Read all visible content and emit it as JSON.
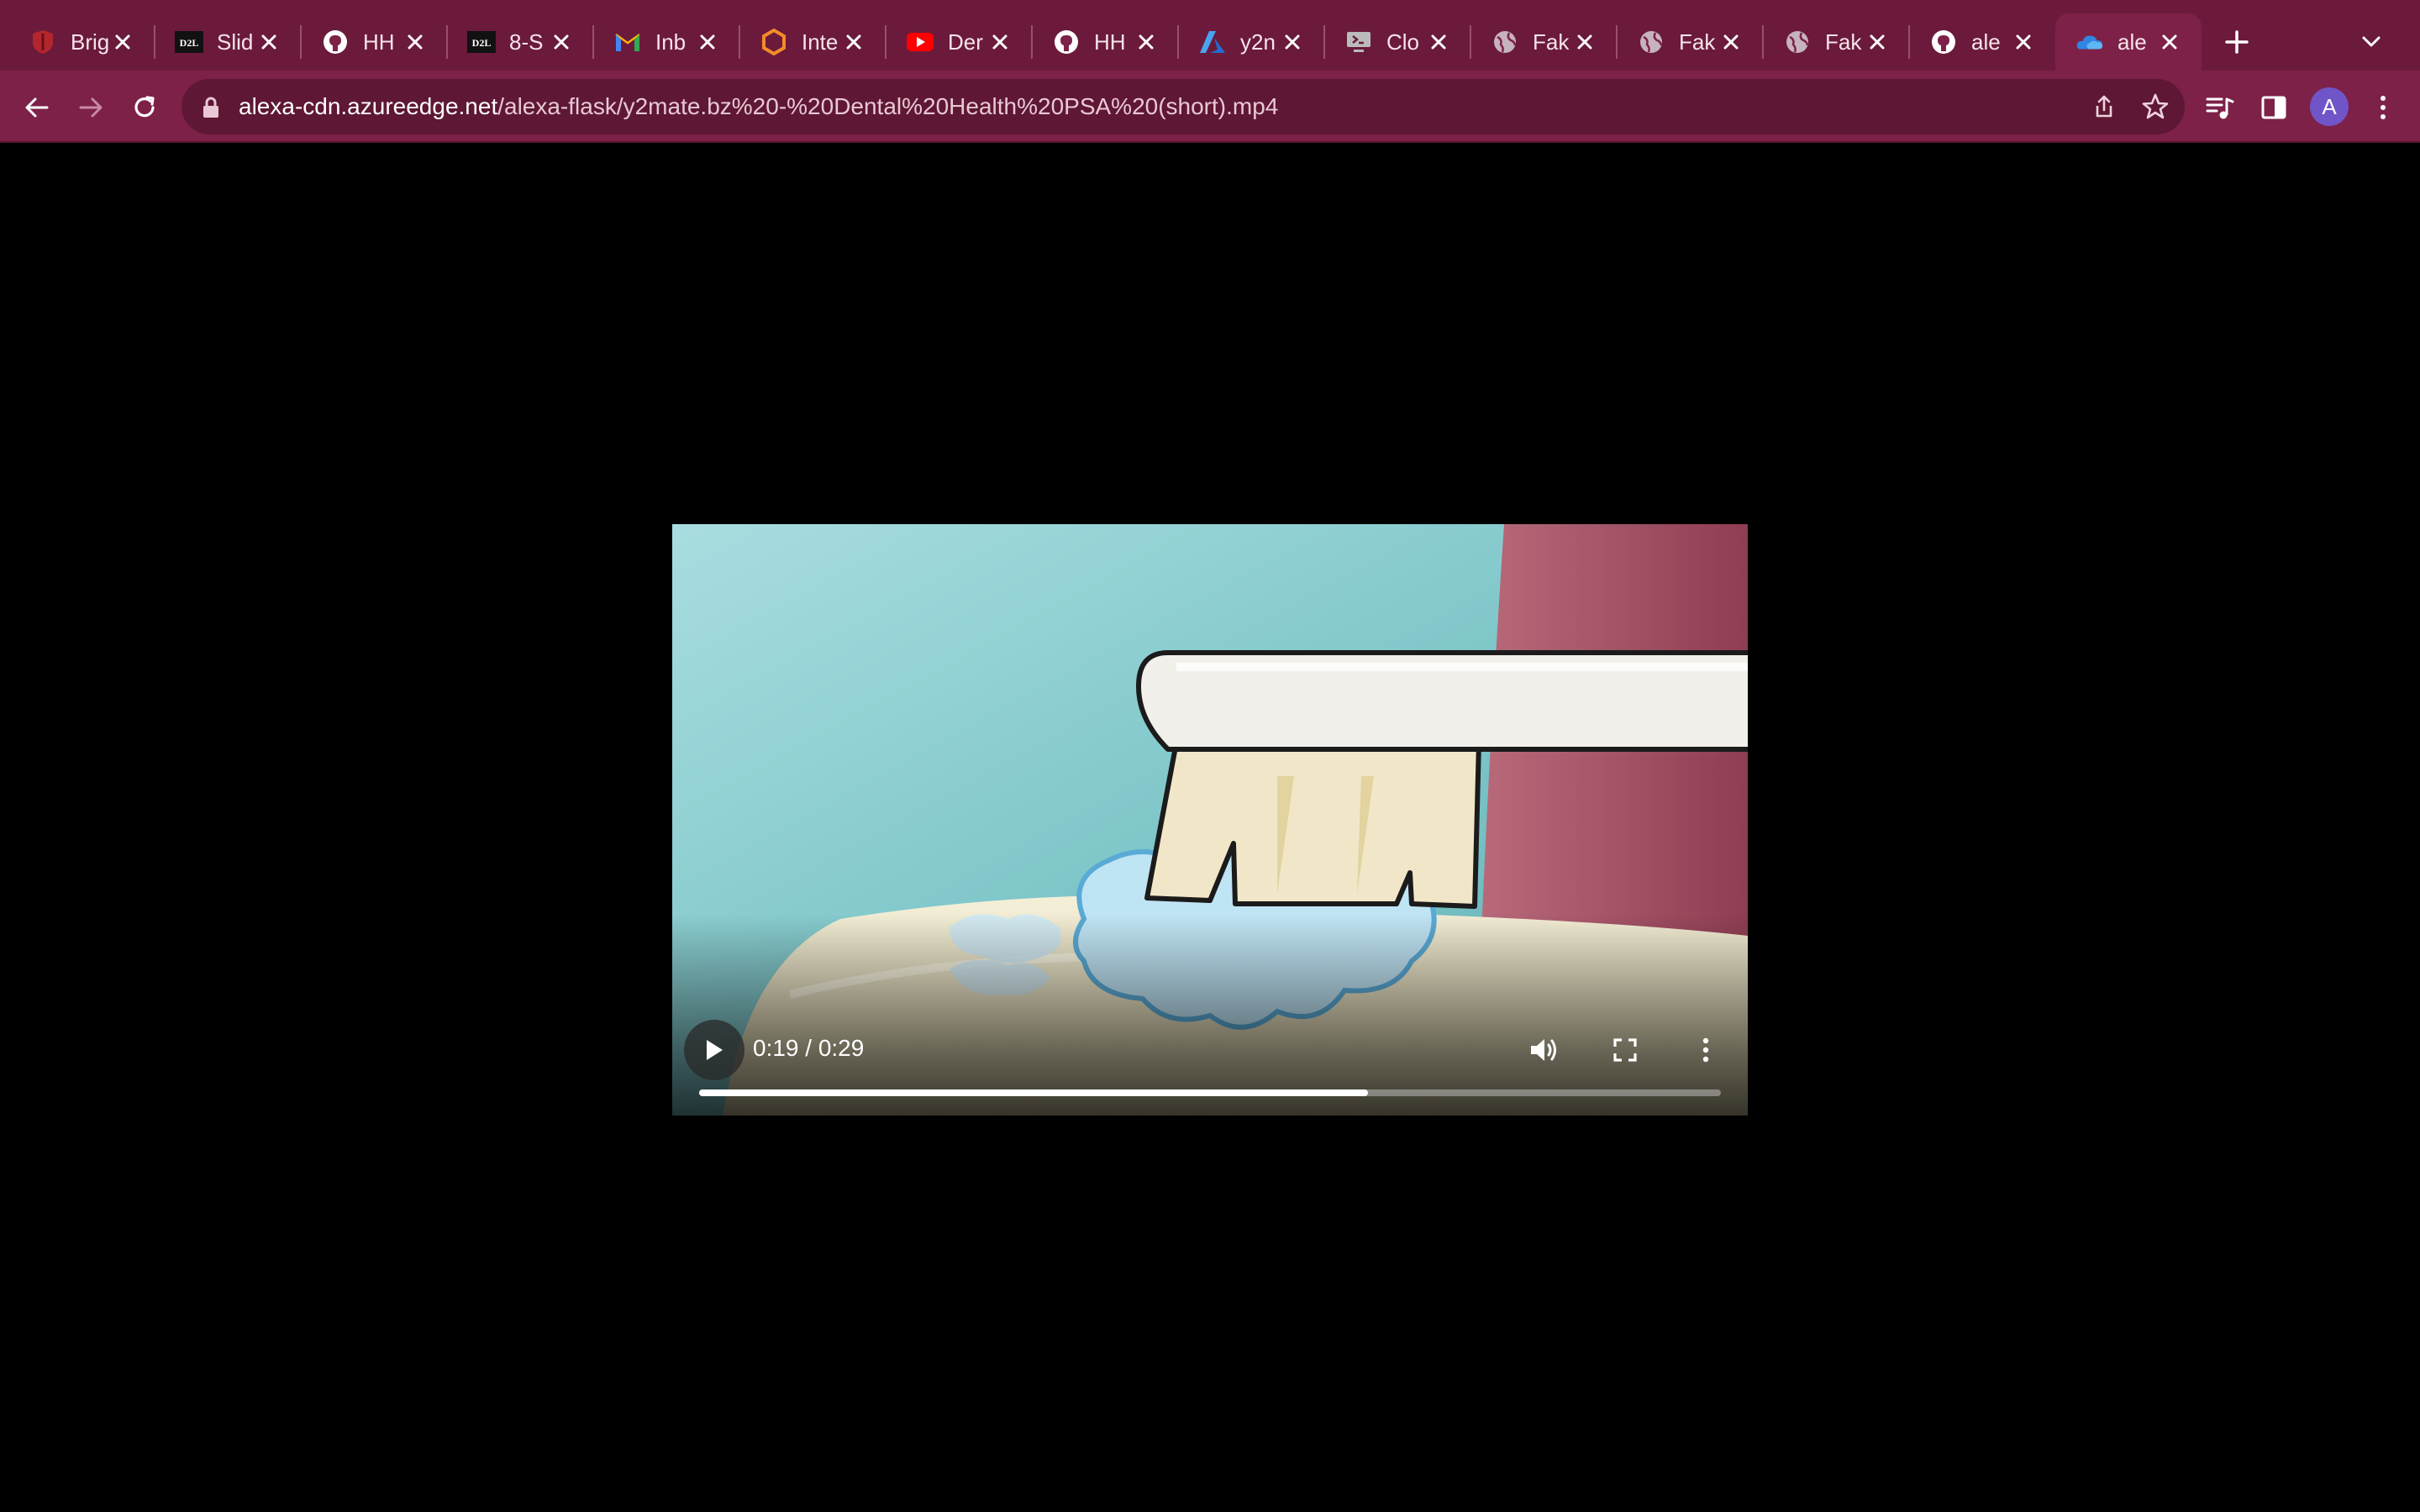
{
  "browser": {
    "tabs": [
      {
        "title": "Brig",
        "icon": "shield-logo-icon",
        "active": false
      },
      {
        "title": "Slid",
        "icon": "d2l-logo-icon",
        "active": false
      },
      {
        "title": "HH",
        "icon": "github-icon",
        "active": false
      },
      {
        "title": "8-S",
        "icon": "d2l-logo-icon",
        "active": false
      },
      {
        "title": "Inb",
        "icon": "gmail-icon",
        "active": false
      },
      {
        "title": "Inte",
        "icon": "hexagon-logo-icon",
        "active": false
      },
      {
        "title": "Der",
        "icon": "youtube-icon",
        "active": false
      },
      {
        "title": "HH",
        "icon": "github-icon",
        "active": false
      },
      {
        "title": "y2n",
        "icon": "azure-icon",
        "active": false
      },
      {
        "title": "Clo",
        "icon": "remote-desktop-icon",
        "active": false
      },
      {
        "title": "Fak",
        "icon": "globe-icon",
        "active": false
      },
      {
        "title": "Fak",
        "icon": "globe-icon",
        "active": false
      },
      {
        "title": "Fak",
        "icon": "globe-icon",
        "active": false
      },
      {
        "title": "ale",
        "icon": "github-icon",
        "active": false
      },
      {
        "title": "ale",
        "icon": "onedrive-cloud-icon",
        "active": true
      }
    ],
    "url_host": "alexa-cdn.azureedge.net",
    "url_path": "/alexa-flask/y2mate.bz%20-%20Dental%20Health%20PSA%20(short).mp4",
    "profile_initial": "A",
    "theme_color": "#6b1a3b"
  },
  "video": {
    "time_display": "0:19 / 0:29",
    "progress_fraction": 0.655,
    "state": "paused"
  }
}
